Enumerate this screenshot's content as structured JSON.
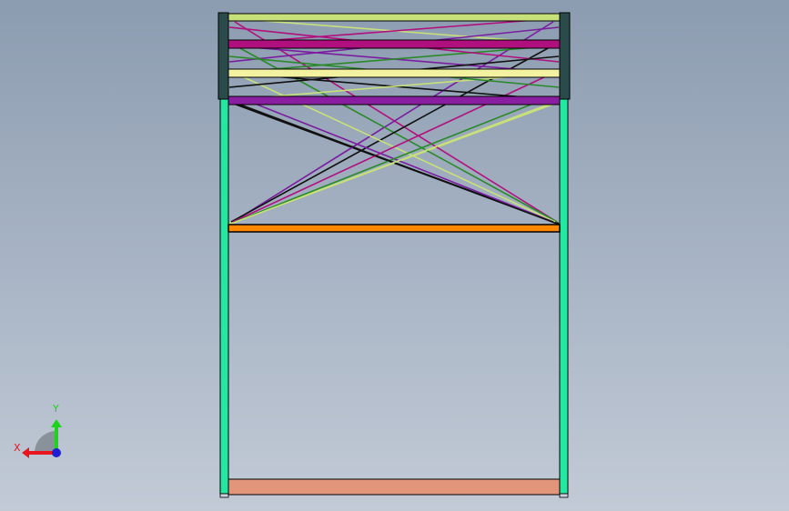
{
  "viewport": {
    "background_top": "#8c9cb0",
    "background_bottom": "#c2cad6"
  },
  "model": {
    "columns_color": "#22e8a2",
    "column_top_color": "#2b4b4b",
    "outline_color": "#000000",
    "top_deck_colors": [
      "#c8e07a",
      "#b0107e",
      "#f2f2a0",
      "#8a1ea0"
    ],
    "mid_beam_color": "#ff8800",
    "base_plate_color": "#e2957b",
    "brace_colors": [
      "#111111",
      "#c8e07a",
      "#b0107e",
      "#7a1ea0",
      "#2a8a2a"
    ]
  },
  "triad": {
    "icon": "coordinate-triad-icon",
    "x_label": "X",
    "y_label": "Y",
    "x_color": "#e8141e",
    "y_color": "#1ed21e",
    "z_color": "#1e1ed2"
  }
}
